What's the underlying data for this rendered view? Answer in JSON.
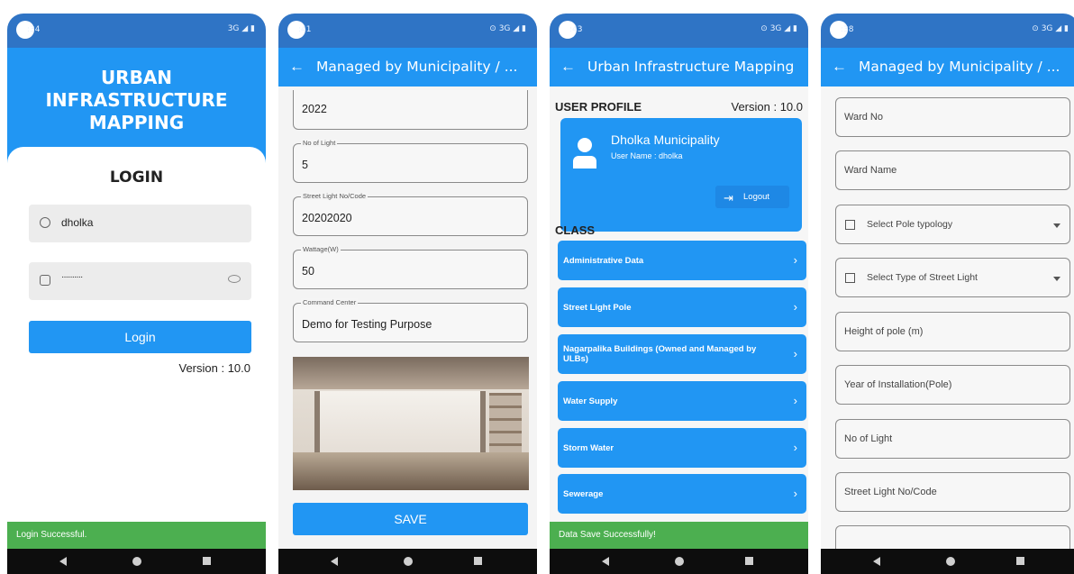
{
  "status": {
    "s1": {
      "time": ":34",
      "right": "3G"
    },
    "s2": {
      "time": ":41",
      "right": "3G"
    },
    "s3": {
      "time": ":43",
      "right": "3G"
    },
    "s4": {
      "time": ":38",
      "right": "3G"
    }
  },
  "screen1": {
    "app_title_line1": "URBAN INFRASTRUCTURE",
    "app_title_line2": "MAPPING",
    "login_title": "LOGIN",
    "username_value": "dholka",
    "password_value": "··········",
    "login_button": "Login",
    "version": "Version : 10.0",
    "snackbar": "Login Successful."
  },
  "screen2": {
    "title": "Managed by Municipality / ...",
    "fields": [
      {
        "label": "",
        "value": "2022"
      },
      {
        "label": "No of Light",
        "value": "5"
      },
      {
        "label": "Street Light No/Code",
        "value": "20202020"
      },
      {
        "label": "Wattage(W)",
        "value": "50"
      },
      {
        "label": "Command Center",
        "value": "Demo for Testing Purpose"
      }
    ],
    "save_button": "SAVE"
  },
  "screen3": {
    "title": "Urban Infrastructure Mapping",
    "profile_heading": "USER PROFILE",
    "version": "Version : 10.0",
    "profile_name": "Dholka Municipality",
    "user_name": "User Name : dholka",
    "logout_button": "Logout",
    "class_heading": "CLASS",
    "classes": [
      "Administrative Data",
      "Street Light Pole",
      "Nagarpalika Buildings (Owned and Managed by ULBs)",
      "Water Supply",
      "Storm Water",
      "Sewerage"
    ],
    "snackbar": "Data Save Successfully!"
  },
  "screen4": {
    "title": "Managed by Municipality / ...",
    "fields": [
      "Ward No",
      "Ward Name",
      "Select Pole typology",
      "Select Type of Street Light",
      "Height of pole (m)",
      "Year of Installation(Pole)",
      "No of Light",
      "Street Light No/Code"
    ]
  },
  "colors": {
    "primary": "#2196f3",
    "status_bar": "#2f74c5",
    "success": "#4caf50",
    "nav_bar": "#0d0d0d"
  },
  "icons": [
    "back-arrow-icon",
    "user-icon",
    "lock-icon",
    "eye-icon",
    "logout-icon",
    "chevron-right-icon",
    "dropdown-caret-icon",
    "list-icon"
  ]
}
